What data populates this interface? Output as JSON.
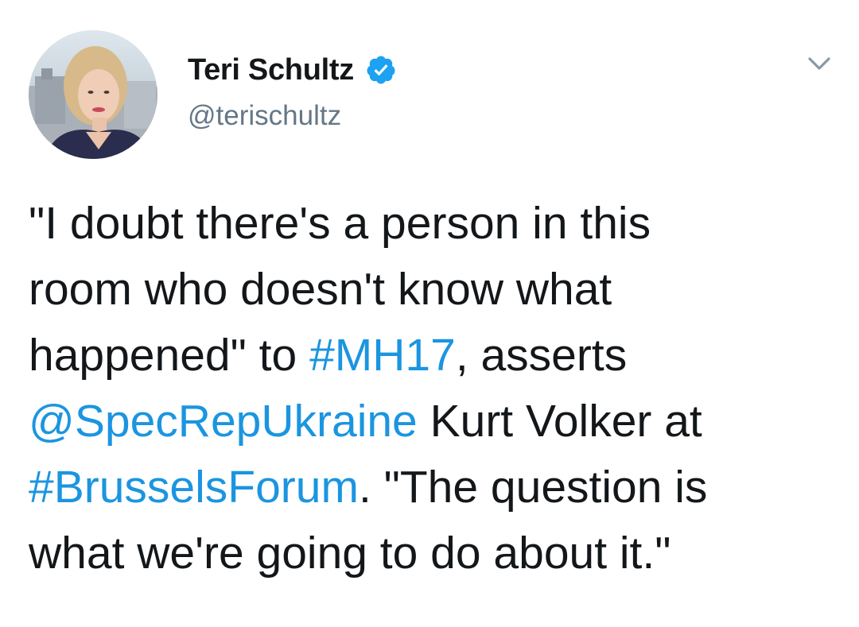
{
  "author": {
    "display_name": "Teri Schultz",
    "handle": "@terischultz",
    "verified_icon": "verified-badge-icon",
    "avatar": "profile-photo"
  },
  "menu": {
    "icon": "chevron-down-icon"
  },
  "colors": {
    "link": "#1b95e0",
    "text": "#14171a",
    "secondary": "#657786",
    "verified": "#1da1f2"
  },
  "tweet": {
    "lines": [
      {
        "segments": [
          {
            "text": "\"I doubt there's a person in this"
          }
        ]
      },
      {
        "segments": [
          {
            "text": "room who doesn't know what"
          }
        ]
      },
      {
        "segments": [
          {
            "text": "happened\" to "
          },
          {
            "text": "#MH17",
            "link": "hashtag"
          },
          {
            "text": ", asserts"
          }
        ]
      },
      {
        "segments": [
          {
            "text": "@SpecRepUkraine",
            "link": "mention"
          },
          {
            "text": " Kurt Volker at"
          }
        ]
      },
      {
        "segments": [
          {
            "text": "#BrusselsForum",
            "link": "hashtag"
          },
          {
            "text": ". \"The question is"
          }
        ]
      },
      {
        "segments": [
          {
            "text": "what we're going to do about it.\""
          }
        ]
      }
    ]
  }
}
